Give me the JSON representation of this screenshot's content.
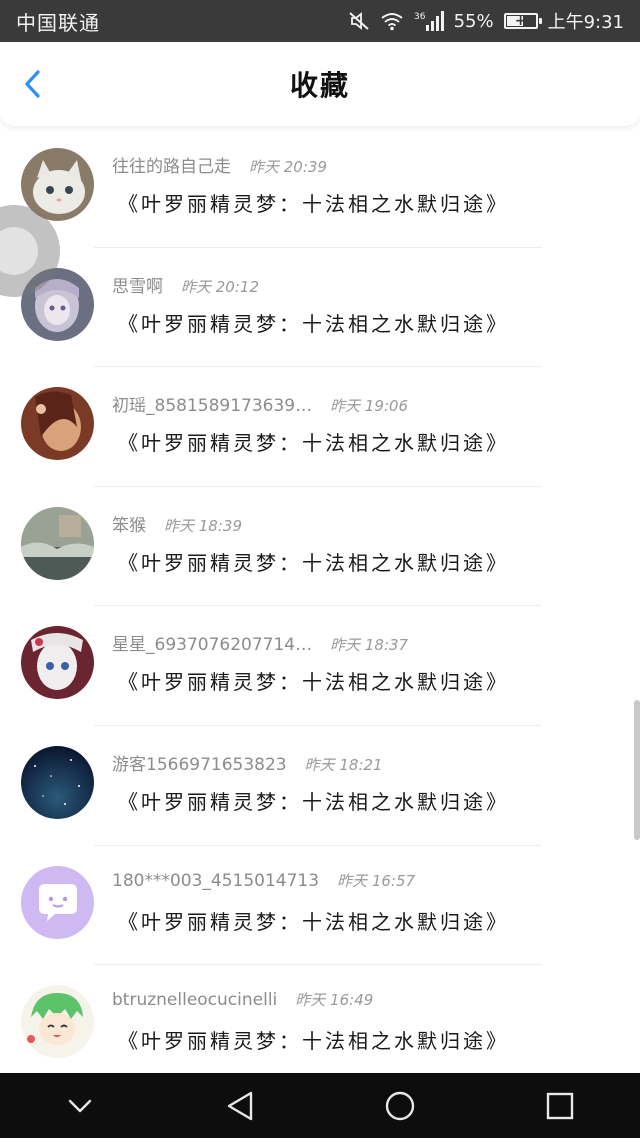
{
  "status_bar": {
    "carrier": "中国联通",
    "signal_label": "36",
    "battery": "55%",
    "battery_level": 0.55,
    "time": "上午9:31"
  },
  "header": {
    "title": "收藏",
    "back_icon": "chevron-left-icon",
    "accent_color": "#2d8ff0"
  },
  "items": [
    {
      "name": "往往的路自己走",
      "time": "昨天 20:39",
      "content": "《叶罗丽精灵梦：十法相之水默归途》"
    },
    {
      "name": "思雪啊",
      "time": "昨天 20:12",
      "content": "《叶罗丽精灵梦：十法相之水默归途》"
    },
    {
      "name": "初瑶_8581589173639…",
      "time": "昨天 19:06",
      "content": "《叶罗丽精灵梦：十法相之水默归途》"
    },
    {
      "name": "笨猴",
      "time": "昨天 18:39",
      "content": "《叶罗丽精灵梦：十法相之水默归途》"
    },
    {
      "name": "星星_6937076207714…",
      "time": "昨天 18:37",
      "content": "《叶罗丽精灵梦：十法相之水默归途》"
    },
    {
      "name": "游客1566971653823",
      "time": "昨天 18:21",
      "content": "《叶罗丽精灵梦：十法相之水默归途》"
    },
    {
      "name": "180***003_4515014713",
      "time": "昨天 16:57",
      "content": "《叶罗丽精灵梦：十法相之水默归途》"
    },
    {
      "name": "btruznelleocucinelli",
      "time": "昨天 16:49",
      "content": "《叶罗丽精灵梦：十法相之水默归途》"
    }
  ],
  "nav": {
    "icons": [
      "chevron-down-icon",
      "back-triangle-icon",
      "home-circle-icon",
      "recents-square-icon"
    ]
  }
}
